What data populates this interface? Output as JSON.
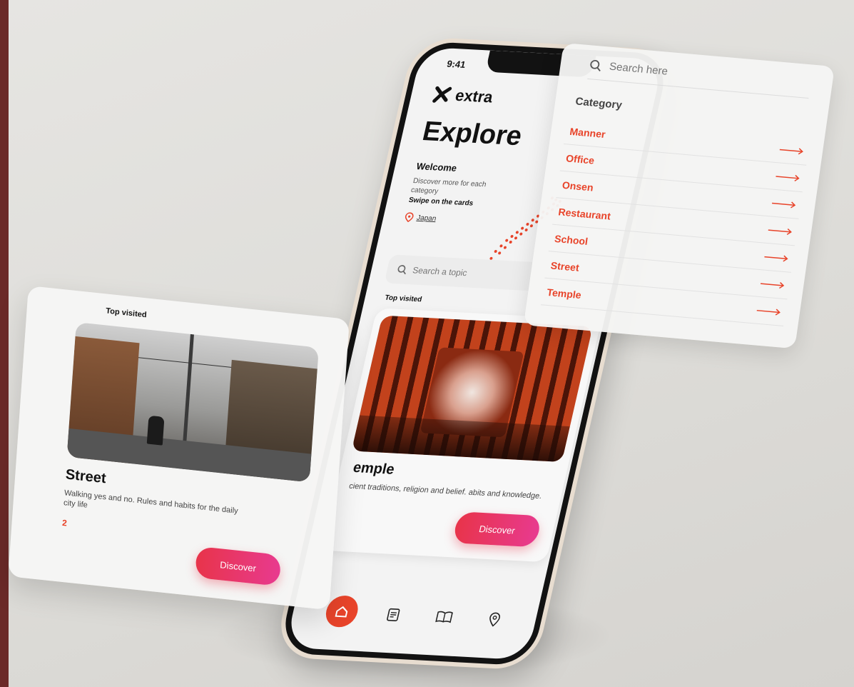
{
  "status_bar": {
    "time": "9:41"
  },
  "brand": {
    "name": "extra"
  },
  "explore": {
    "title": "Explore",
    "welcome": "Welcome",
    "description": "Discover more for each category",
    "swipe_hint": "Swipe on the cards",
    "location": "Japan"
  },
  "phone_search": {
    "placeholder": "Search a topic"
  },
  "phone_card": {
    "section_label": "Top visited",
    "title": "emple",
    "description": "cient traditions, religion and belief. abits and knowledge.",
    "button": "Discover"
  },
  "bottom_nav": {
    "items": [
      {
        "icon": "home-icon"
      },
      {
        "icon": "clipboard-icon"
      },
      {
        "icon": "book-icon"
      },
      {
        "icon": "location-pin-icon"
      }
    ]
  },
  "category_panel": {
    "search_placeholder": "Search here",
    "heading": "Category",
    "items": [
      {
        "label": "Manner"
      },
      {
        "label": "Office"
      },
      {
        "label": "Onsen"
      },
      {
        "label": "Restaurant"
      },
      {
        "label": "School"
      },
      {
        "label": "Street"
      },
      {
        "label": "Temple"
      }
    ]
  },
  "street_card": {
    "section_label": "Top visited",
    "title": "Street",
    "description": "Walking yes and no. Rules and habits for the daily city life",
    "page_indicator": "2",
    "button": "Discover"
  },
  "colors": {
    "accent": "#e8442a",
    "button_gradient_start": "#e8344a",
    "button_gradient_end": "#e83a8f",
    "background": "#e2e1de"
  }
}
